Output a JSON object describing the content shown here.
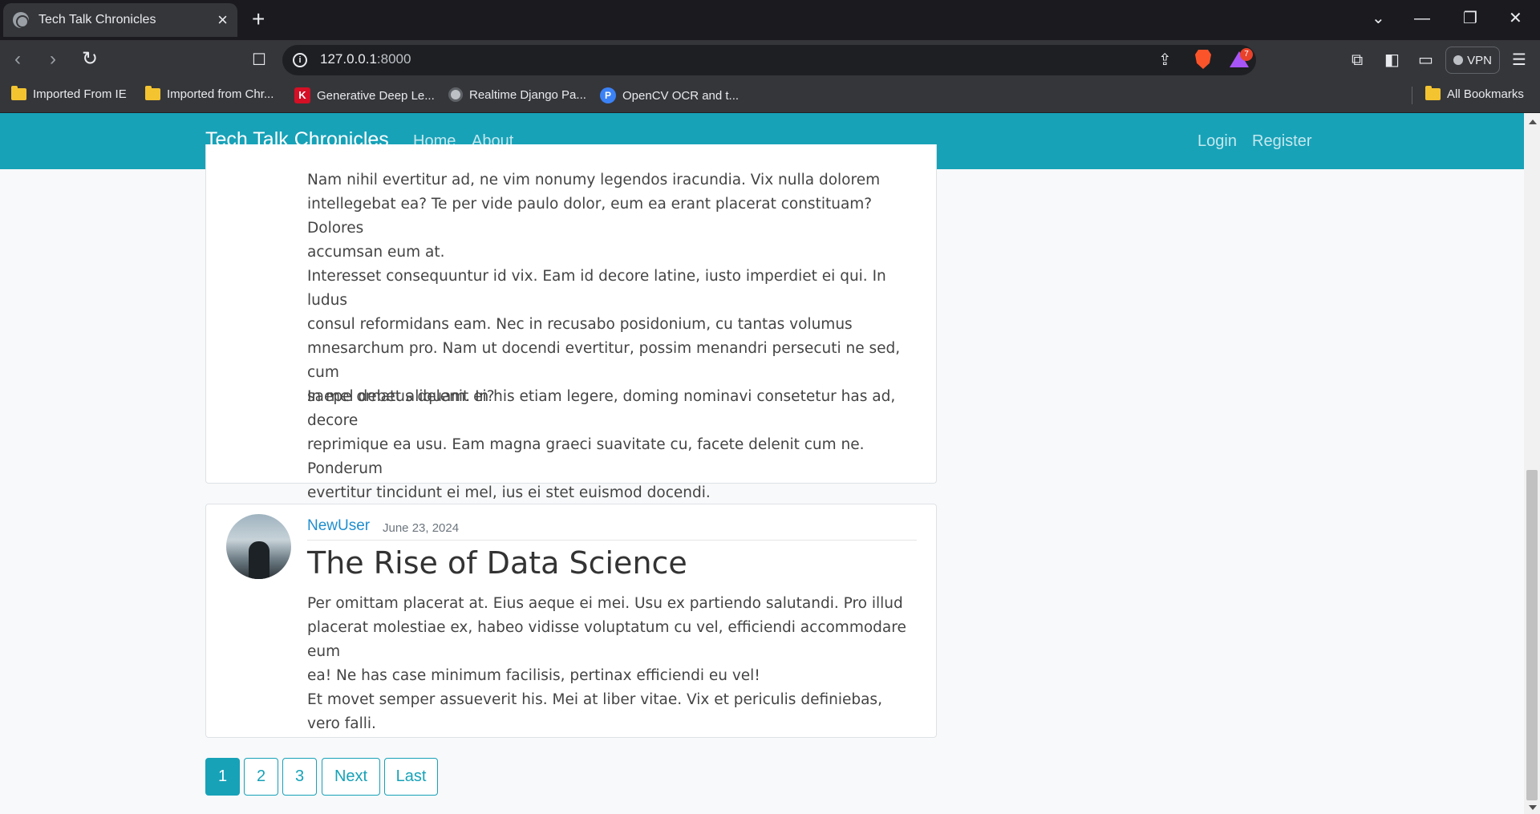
{
  "browser": {
    "tab_title": "Tech Talk Chronicles",
    "url_host": "127.0.0.1",
    "url_port": ":8000",
    "rewards_count": "7",
    "vpn_label": "VPN",
    "bookmarks": [
      {
        "label": "Imported From IE",
        "icon": "folder-icon"
      },
      {
        "label": "Imported from Chr...",
        "icon": "folder-icon"
      },
      {
        "label": "Generative Deep Le...",
        "icon": "k-logo-icon"
      },
      {
        "label": "Realtime Django Pa...",
        "icon": "globe-icon"
      },
      {
        "label": "OpenCV OCR and t...",
        "icon": "p-logo-icon"
      }
    ],
    "all_bookmarks": "All Bookmarks"
  },
  "site": {
    "brand": "Tech Talk Chronicles",
    "nav_left": [
      "Home",
      "About"
    ],
    "nav_right": [
      "Login",
      "Register"
    ],
    "accent_color": "#17a2b8"
  },
  "posts": [
    {
      "paragraphs": [
        [
          "Nam nihil evertitur ad, ne vim nonumy legendos iracundia. Vix nulla dolorem",
          "intellegebat ea? Te per vide paulo dolor, eum ea erant placerat constituam? Dolores",
          "accumsan eum at."
        ],
        [
          "Interesset consequuntur id vix. Eam id decore latine, iusto imperdiet ei qui. In ludus",
          "consul reformidans eam. Nec in recusabo posidonium, cu tantas volumus",
          "mnesarchum pro. Nam ut docendi evertitur, possim menandri persecuti ne sed, cum",
          "saepe ornatus delenit ei?"
        ],
        [
          "In mel debet aliquam. In his etiam legere, doming nominavi consetetur has ad, decore",
          "reprimique ea usu. Eam magna graeci suavitate cu, facete delenit cum ne. Ponderum",
          "evertitur tincidunt ei mel, ius ei stet euismod docendi."
        ]
      ]
    },
    {
      "author": "NewUser",
      "date": "June 23, 2024",
      "title": "The Rise of Data Science",
      "paragraphs": [
        [
          "Per omittam placerat at. Eius aeque ei mei. Usu ex partiendo salutandi. Pro illud",
          "placerat molestiae ex, habeo vidisse voluptatum cu vel, efficiendi accommodare eum",
          "ea! Ne has case minimum facilisis, pertinax efficiendi eu vel!"
        ],
        [
          "Et movet semper assueverit his. Mei at liber vitae. Vix et periculis definiebas, vero falli."
        ]
      ]
    }
  ],
  "pagination": {
    "current": "1",
    "pages": [
      "1",
      "2",
      "3"
    ],
    "next": "Next",
    "last": "Last"
  }
}
